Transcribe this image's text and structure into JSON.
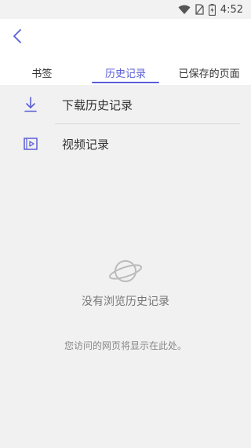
{
  "status_bar": {
    "time": "4:52",
    "icons": [
      "wifi-icon",
      "no-sim-icon",
      "battery-charging-icon"
    ]
  },
  "header": {
    "back_icon": "back-arrow-icon"
  },
  "tabs": [
    {
      "label": "书签",
      "active": false
    },
    {
      "label": "历史记录",
      "active": true
    },
    {
      "label": "已保存的页面",
      "active": false
    }
  ],
  "list": {
    "items": [
      {
        "label": "下载历史记录",
        "icon": "download-icon"
      },
      {
        "label": "视频记录",
        "icon": "video-icon"
      }
    ]
  },
  "empty_state": {
    "icon": "planet-icon",
    "title": "没有浏览历史记录",
    "subtitle": "您访问的网页将显示在此处。"
  },
  "colors": {
    "accent": "#5a5fd6",
    "background": "#f1f1f1",
    "header_bg": "#ffffff"
  }
}
